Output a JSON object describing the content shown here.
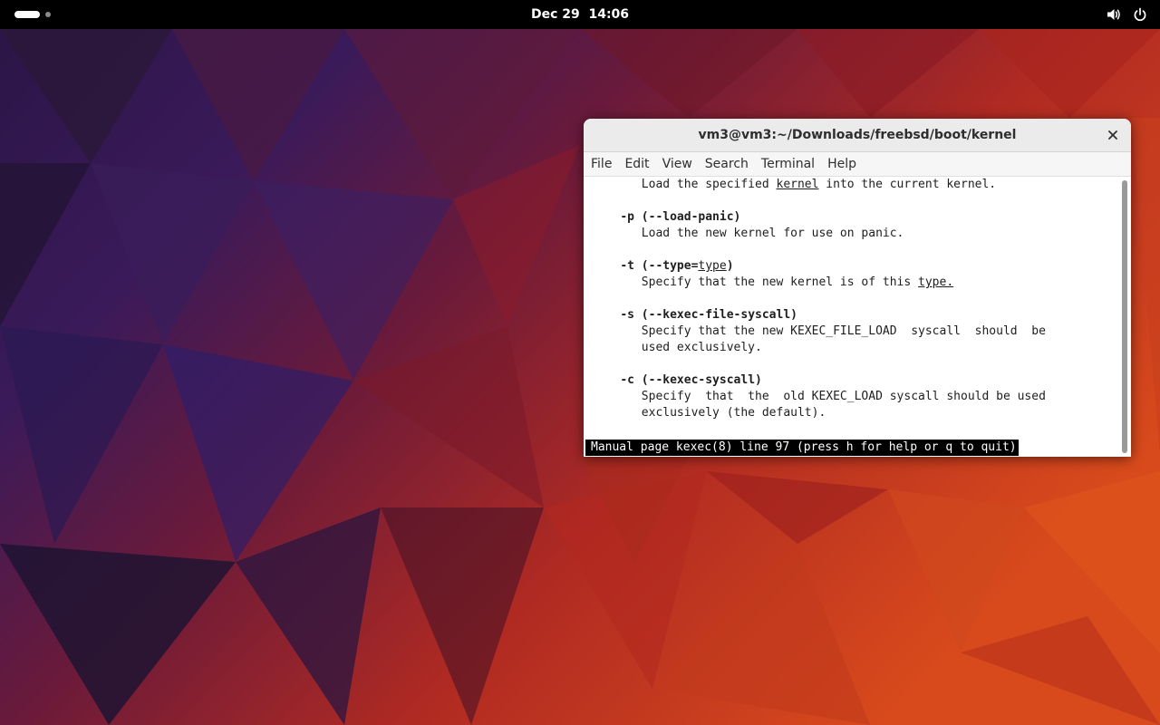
{
  "topbar": {
    "clock": "Dec 29  14:06",
    "workspace_indicator": "activities-indicator",
    "icons": [
      "volume-icon",
      "power-icon"
    ]
  },
  "window": {
    "title": "vm3@vm3:~/Downloads/freebsd/boot/kernel",
    "close_glyph": "×",
    "menu": {
      "file": "File",
      "edit": "Edit",
      "view": "View",
      "search": "Search",
      "terminal": "Terminal",
      "help": "Help"
    }
  },
  "terminal": {
    "l_load_pre": "       Load the specified ",
    "l_load_kernel": "kernel",
    "l_load_post": " into the current kernel.",
    "opt_p": "-p (--load-panic)",
    "opt_p_desc": "       Load the new kernel for use on panic.",
    "opt_t_pre": "-t (--type=",
    "opt_t_arg": "type",
    "opt_t_post": ")",
    "opt_t_desc_pre": "       Specify that the new kernel is of this ",
    "opt_t_desc_u": "type.",
    "opt_s": "-s (--kexec-file-syscall)",
    "opt_s_desc1": "       Specify that the new KEXEC_FILE_LOAD  syscall  should  be",
    "opt_s_desc2": "       used exclusively.",
    "opt_c": "-c (--kexec-syscall)",
    "opt_c_desc1": "       Specify  that  the  old KEXEC_LOAD syscall should be used",
    "opt_c_desc2": "       exclusively (the default).",
    "status": "Manual page kexec(8) line 97 (press h for help or q to quit)"
  },
  "colors": {
    "topbar_bg": "#000000",
    "titlebar_bg": "#ebebeb",
    "terminal_bg": "#ffffff",
    "terminal_fg": "#1e1e1e"
  }
}
